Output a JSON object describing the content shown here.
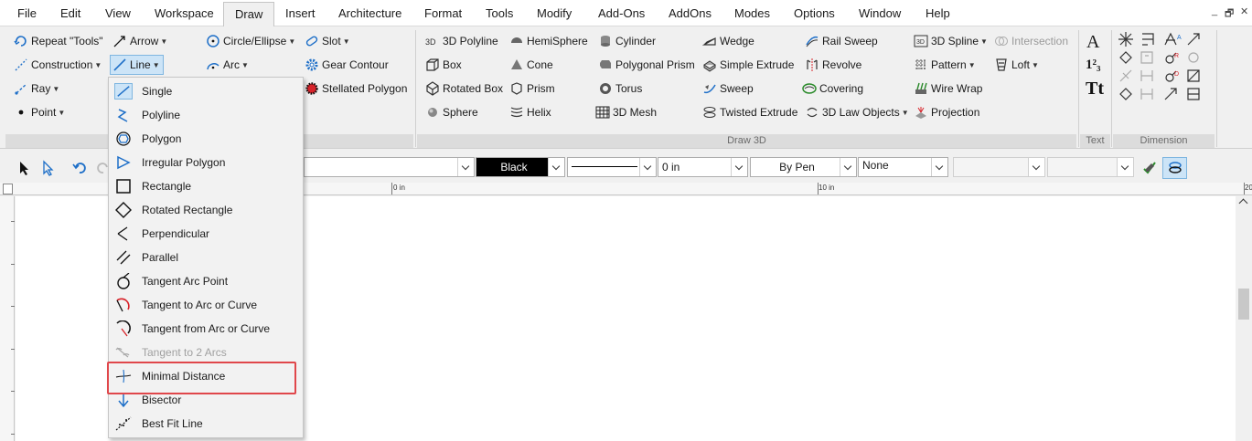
{
  "menubar": {
    "items": [
      "File",
      "Edit",
      "View",
      "Workspace",
      "Draw",
      "Insert",
      "Architecture",
      "Format",
      "Tools",
      "Modify",
      "Add-Ons",
      "AddOns",
      "Modes",
      "Options",
      "Window",
      "Help"
    ],
    "active": "Draw",
    "window_controls": [
      "_",
      "🗗",
      "✕"
    ]
  },
  "ribbon": {
    "draw2d": {
      "repeat_tools": "Repeat \"Tools\"",
      "construction": "Construction",
      "ray": "Ray",
      "point": "Point",
      "arrow": "Arrow",
      "line": "Line",
      "circle_ellipse": "Circle/Ellipse",
      "arc": "Arc",
      "slot": "Slot",
      "gear_contour": "Gear Contour",
      "stellated_polygon": "Stellated Polygon"
    },
    "draw3d": {
      "label": "Draw 3D",
      "col1": [
        "3D Polyline",
        "Box",
        "Rotated Box",
        "Sphere"
      ],
      "col2": [
        "HemiSphere",
        "Cone",
        "Prism",
        "Helix"
      ],
      "col3": [
        "Cylinder",
        "Polygonal Prism",
        "Torus",
        "3D Mesh"
      ],
      "col4": [
        "Wedge",
        "Simple Extrude",
        "Sweep",
        "Twisted Extrude"
      ],
      "col5": [
        "Rail Sweep",
        "Revolve",
        "Covering",
        "3D Law Objects"
      ],
      "col6": [
        "3D Spline",
        "Pattern",
        "Wire Wrap",
        "Projection"
      ],
      "intersection": "Intersection",
      "loft": "Loft"
    },
    "text_group": {
      "label": "Text",
      "glyph_a": "A",
      "glyph_123": "1²₃",
      "glyph_tt": "Tt"
    },
    "dimension_group": {
      "label": "Dimension"
    }
  },
  "toolbar": {
    "color": "Black",
    "line_weight": "0 in",
    "pen": "By Pen",
    "fill": "None"
  },
  "ruler": {
    "label_0": "0 in",
    "label_10": "10 in",
    "label_20": "20"
  },
  "line_menu": {
    "items": [
      {
        "label": "Single",
        "icon": "single-line-icon"
      },
      {
        "label": "Polyline",
        "icon": "polyline-icon"
      },
      {
        "label": "Polygon",
        "icon": "polygon-icon"
      },
      {
        "label": "Irregular Polygon",
        "icon": "irregular-polygon-icon"
      },
      {
        "label": "Rectangle",
        "icon": "rectangle-icon"
      },
      {
        "label": "Rotated Rectangle",
        "icon": "rotated-rectangle-icon"
      },
      {
        "label": "Perpendicular",
        "icon": "perpendicular-icon"
      },
      {
        "label": "Parallel",
        "icon": "parallel-icon"
      },
      {
        "label": "Tangent Arc Point",
        "icon": "tangent-arc-point-icon"
      },
      {
        "label": "Tangent to Arc or Curve",
        "icon": "tangent-to-arc-icon"
      },
      {
        "label": "Tangent from Arc or Curve",
        "icon": "tangent-from-arc-icon"
      },
      {
        "label": "Tangent to 2 Arcs",
        "icon": "tangent-two-arcs-icon"
      },
      {
        "label": "Minimal Distance",
        "icon": "minimal-distance-icon"
      },
      {
        "label": "Bisector",
        "icon": "bisector-icon"
      },
      {
        "label": "Best Fit Line",
        "icon": "best-fit-line-icon"
      }
    ],
    "highlighted": "Minimal Distance",
    "disabled": "Tangent to 2 Arcs"
  },
  "colors": {
    "highlight_box": "#e0474b",
    "selection": "#cce4f7",
    "accent": "#1e6fc8"
  }
}
